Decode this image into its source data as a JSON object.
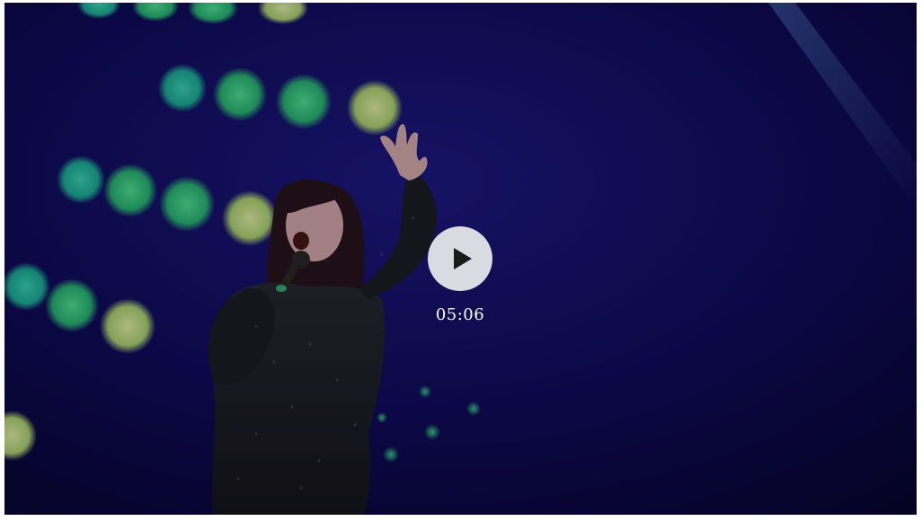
{
  "video": {
    "duration": "05:06",
    "play_icon": "play-icon",
    "poster_description_icon": "singer-on-stage-image"
  },
  "colors": {
    "overlay": "#000000",
    "play_button_bg": "#ebebee",
    "play_icon": "#1a1a1a",
    "duration_text": "#ffffff"
  }
}
